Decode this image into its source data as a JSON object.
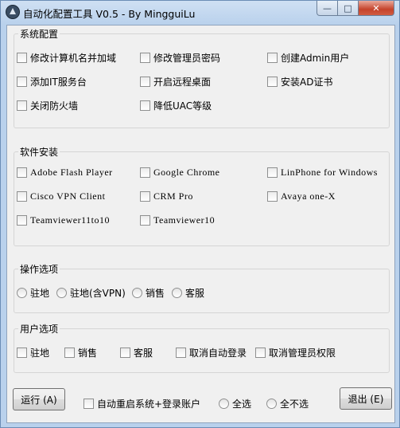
{
  "window": {
    "title": "自动化配置工具 V0.5  - By MingguiLu",
    "min_glyph": "—",
    "max_glyph": "□",
    "close_glyph": "✕"
  },
  "groups": {
    "system": {
      "title": "系统配置",
      "items": [
        "修改计算机名并加域",
        "修改管理员密码",
        "创建Admin用户",
        "添加IT服务台",
        "开启远程桌面",
        "安装AD证书",
        "关闭防火墙",
        "降低UAC等级"
      ]
    },
    "software": {
      "title": "软件安装",
      "items": [
        "Adobe Flash Player",
        "Google Chrome",
        "LinPhone for Windows",
        "Cisco VPN Client",
        "CRM Pro",
        "Avaya one-X",
        "Teamviewer11to10",
        "Teamviewer10"
      ]
    },
    "operation": {
      "title": "操作选项",
      "options": [
        "驻地",
        "驻地(含VPN)",
        "销售",
        "客服"
      ]
    },
    "user": {
      "title": "用户选项",
      "items": [
        "驻地",
        "销售",
        "客服",
        "取消自动登录",
        "取消管理员权限"
      ]
    }
  },
  "bottom": {
    "run_label": "运行 (A)",
    "auto_restart_label": "自动重启系统+登录账户",
    "select_all_label": "全选",
    "select_none_label": "全不选",
    "exit_label": "退出 (E)"
  }
}
